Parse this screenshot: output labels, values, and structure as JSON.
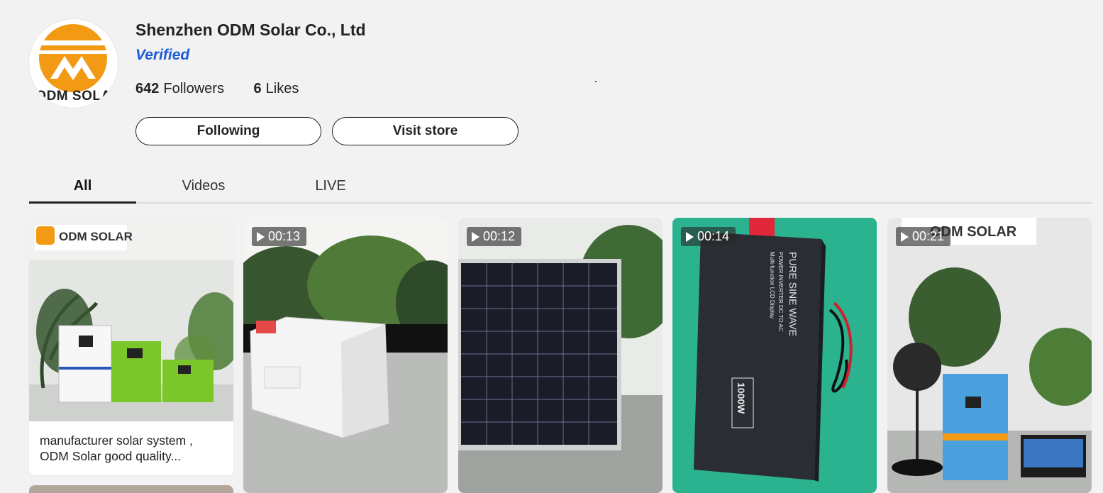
{
  "shop": {
    "name": "Shenzhen ODM Solar Co., Ltd",
    "verified_label": "Verified",
    "avatar_text": "ODM SOLA",
    "followers_count": "642",
    "followers_label": "Followers",
    "likes_count": "6",
    "likes_label": "Likes"
  },
  "actions": {
    "following_label": "Following",
    "visit_store_label": "Visit store"
  },
  "tabs": [
    {
      "label": "All",
      "active": true
    },
    {
      "label": "Videos",
      "active": false
    },
    {
      "label": "LIVE",
      "active": false
    }
  ],
  "cards": [
    {
      "type": "product",
      "brand_text": "ODM SOLAR",
      "caption": "manufacturer solar system , ODM Solar good quality..."
    },
    {
      "type": "video",
      "duration": "00:13"
    },
    {
      "type": "video",
      "duration": "00:12"
    },
    {
      "type": "video",
      "duration": "00:14",
      "inverter_text_1": "PURE SINE WAVE",
      "inverter_text_2": "POWER INVERTER DC TO AC",
      "inverter_text_3": "Multi-function LCD Display",
      "inverter_power": "1000W"
    },
    {
      "type": "video",
      "duration": "00:21",
      "brand_text": "ODM SOLAR"
    }
  ],
  "colors": {
    "brand_orange": "#f39a14",
    "verified_blue": "#1d5bd6",
    "page_bg": "#f2f2f2"
  }
}
